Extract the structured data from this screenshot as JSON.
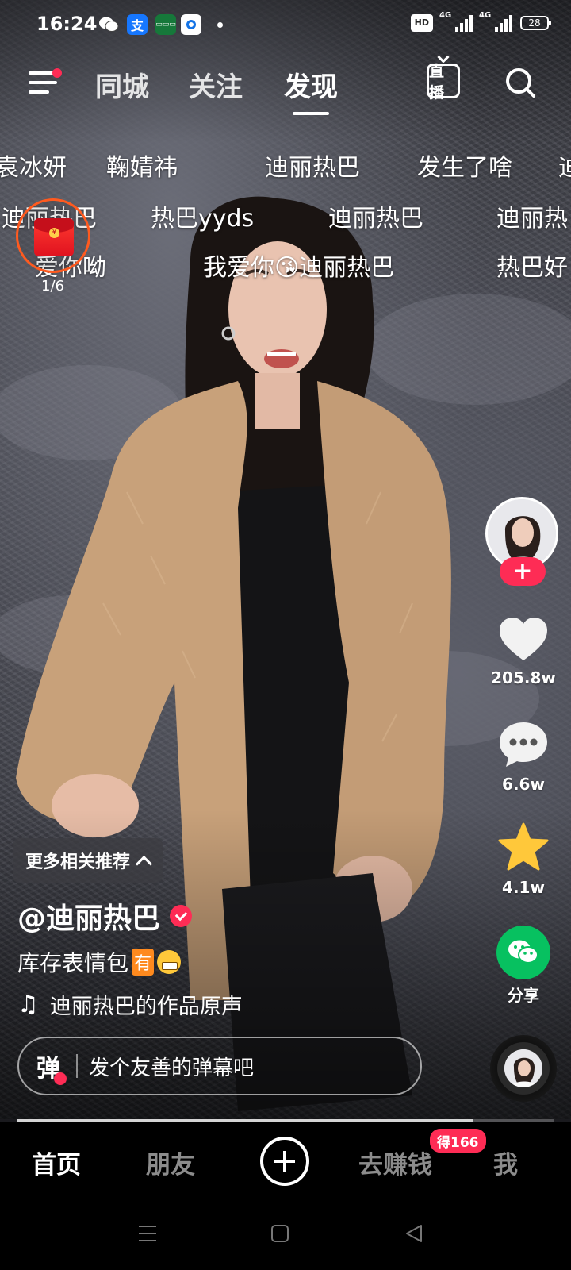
{
  "status_bar": {
    "time": "16:24",
    "alipay_glyph": "支",
    "hd_label": "HD",
    "signal1_label": "4G",
    "signal2_label": "4G",
    "battery": "28"
  },
  "top_nav": {
    "tabs": [
      "同城",
      "关注",
      "发现"
    ],
    "active_tab": "发现",
    "live_label": "直播"
  },
  "danmaku": [
    "袁冰妍",
    "鞠婧祎",
    "迪丽热巴",
    "发生了啥",
    "迪",
    "迪丽热巴",
    "热巴yyds",
    "迪丽热巴",
    "迪丽热",
    "爱你呦",
    "我爱你😘迪丽热巴",
    "热巴好"
  ],
  "red_packet": {
    "count": "1/6",
    "coin_glyph": "¥"
  },
  "right_rail": {
    "follow_label": "+",
    "likes": "205.8w",
    "comments": "6.6w",
    "favorites": "4.1w",
    "share_label": "分享"
  },
  "info": {
    "more_recommend": "更多相关推荐",
    "author": "@迪丽热巴",
    "caption_text": "库存表情包",
    "caption_badge": "有",
    "music": "迪丽热巴的作品原声"
  },
  "danmu_bar": {
    "toggle_label": "弹",
    "placeholder": "发个友善的弹幕吧"
  },
  "progress": {
    "played_fraction": 0.85
  },
  "tabbar": {
    "home": "首页",
    "friends": "朋友",
    "earn": "去赚钱",
    "earn_badge": "得166",
    "me": "我"
  },
  "icons": {
    "menu": "menu-icon",
    "live": "live-tv-icon",
    "search": "search-icon",
    "heart": "heart-icon",
    "comment": "comment-bubble-icon",
    "star": "star-icon",
    "share": "wechat-share-icon",
    "music_note": "music-note-icon",
    "plus": "plus-icon"
  },
  "colors": {
    "accent": "#fe2c55",
    "share_green": "#07c160",
    "star": "#ffc83a",
    "red_packet_ring": "#ff5a1f"
  }
}
